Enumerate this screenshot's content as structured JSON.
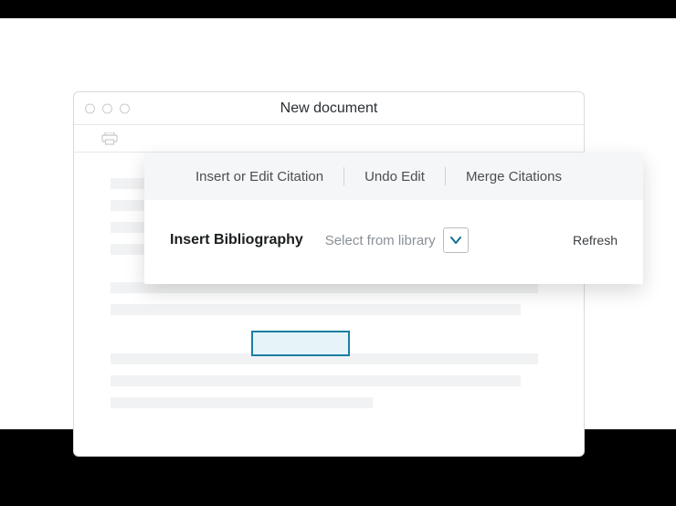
{
  "window": {
    "title": "New document"
  },
  "panel": {
    "top": {
      "insert_edit": "Insert or Edit Citation",
      "undo": "Undo Edit",
      "merge": "Merge Citations"
    },
    "body": {
      "insert_bibliography": "Insert Bibliography",
      "select_placeholder": "Select from library",
      "refresh": "Refresh"
    }
  },
  "icons": {
    "print": "print-icon",
    "chevron_down": "chevron-down-icon",
    "traffic_light": "window-control-icon"
  }
}
